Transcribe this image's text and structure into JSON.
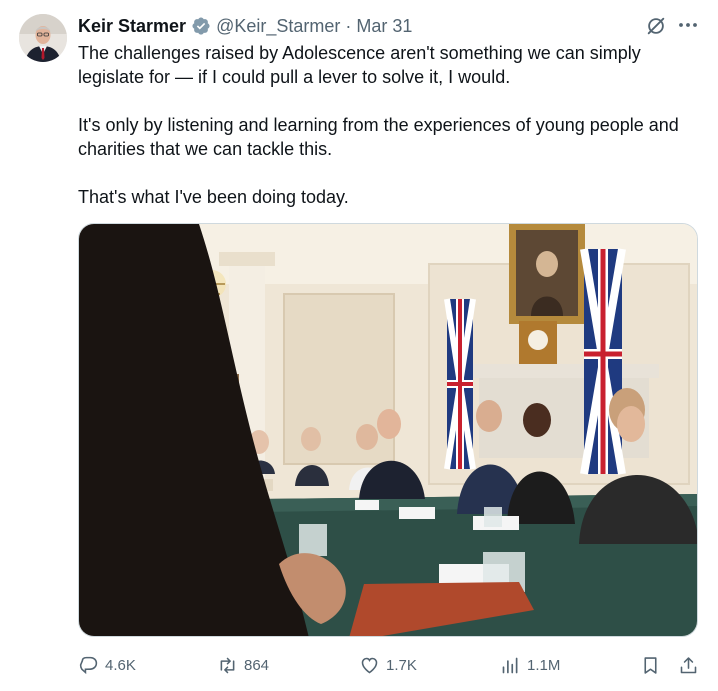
{
  "author": {
    "name": "Keir Starmer",
    "handle": "@Keir_Starmer",
    "separator": "·",
    "date": "Mar 31",
    "verified_icon": "verified-badge-icon"
  },
  "tweet": {
    "paragraphs": [
      "The challenges raised by Adolescence aren't something we can simply legislate for — if I could pull a lever to solve it, I would.",
      "It's only by listening and learning from the experiences of young people and charities that we can tackle this.",
      "That's what I've been doing today."
    ]
  },
  "media": {
    "description_icon": "meeting-photo",
    "accent_colors": {
      "table": "#2e4f47",
      "walls": "#efe6d6",
      "folder": "#b0492c",
      "flag_blue": "#1f3a80",
      "flag_red": "#c8202f"
    }
  },
  "actions": {
    "replies": "4.6K",
    "reposts": "864",
    "likes": "1.7K",
    "views": "1.1M"
  },
  "colors": {
    "text": "#0f1419",
    "secondary": "#536471",
    "verified": "#829aab"
  }
}
